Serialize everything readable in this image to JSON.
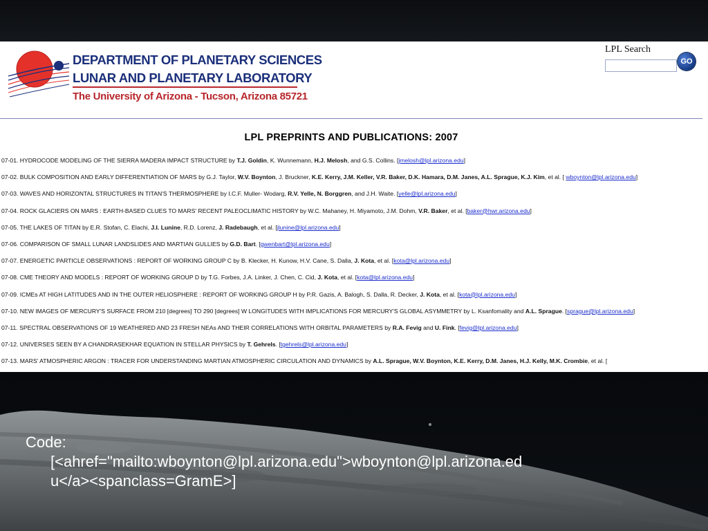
{
  "header": {
    "dept_line1": "DEPARTMENT OF PLANETARY SCIENCES",
    "dept_line2": "LUNAR AND PLANETARY LABORATORY",
    "university": "The University of Arizona - Tucson, Arizona 85721",
    "search_label": "LPL Search",
    "search_value": "",
    "go_label": "GO",
    "logo_icon": "planet-orbit-logo-icon"
  },
  "page_title": "LPL PREPRINTS AND PUBLICATIONS:  2007",
  "publications": [
    {
      "num": "07-01.",
      "segments": [
        {
          "t": "HYDROCODE MODELING OF THE SIERRA MADERA IMPACT STRUCTURE by "
        },
        {
          "t": "T.J. Goldin",
          "b": true
        },
        {
          "t": ", K. Wunnemann, "
        },
        {
          "t": "H.J. Melosh",
          "b": true
        },
        {
          "t": ", and G.S. Collins.  ["
        },
        {
          "t": "jmelosh@lpl.arizona.edu",
          "link": true
        },
        {
          "t": "]"
        }
      ]
    },
    {
      "num": "07-02.",
      "segments": [
        {
          "t": "BULK COMPOSITION AND EARLY DIFFERENTIATION OF MARS by G.J. Taylor, "
        },
        {
          "t": "W.V. Boynton",
          "b": true
        },
        {
          "t": ", J. Bruckner, "
        },
        {
          "t": "K.E. Kerry, J.M. Keller, V.R. Baker, D.K. Hamara, D.M. Janes, A.L. Sprague, K.J. Kim",
          "b": true
        },
        {
          "t": ", et al.  [ "
        },
        {
          "t": "wboynton@lpl.arizona.edu",
          "link": true
        },
        {
          "t": "]"
        }
      ]
    },
    {
      "num": "07-03.",
      "segments": [
        {
          "t": "WAVES AND HORIZONTAL STRUCTURES IN TITAN'S THERMOSPHERE by I.C.F. Muller- Wodarg, "
        },
        {
          "t": "R.V. Yelle, N. Borggren",
          "b": true
        },
        {
          "t": ", and J.H. Waite.  ["
        },
        {
          "t": "yelle@lpl.arizona.edu",
          "link": true
        },
        {
          "t": "]"
        }
      ]
    },
    {
      "num": "07-04.",
      "segments": [
        {
          "t": "ROCK GLACIERS ON MARS : EARTH-BASED CLUES TO MARS' RECENT PALEOCLIMATIC HISTORY by W.C. Mahaney, H. Miyamoto, J.M. Dohm, "
        },
        {
          "t": "V.R. Baker",
          "b": true
        },
        {
          "t": ", et al.  ["
        },
        {
          "t": "baker@hwr.arizona.edu",
          "link": true
        },
        {
          "t": "]"
        }
      ]
    },
    {
      "num": "07-05.",
      "segments": [
        {
          "t": "THE LAKES OF TITAN by E.R. Stofan, C. Elachi, "
        },
        {
          "t": "J.I. Lunine",
          "b": true
        },
        {
          "t": ", R.D. Lorenz, "
        },
        {
          "t": "J. Radebaugh",
          "b": true
        },
        {
          "t": ", et al.  ["
        },
        {
          "t": "jlunine@lpl.arizona.edu",
          "link": true
        },
        {
          "t": "]"
        }
      ]
    },
    {
      "num": "07-06.",
      "segments": [
        {
          "t": "COMPARISON OF SMALL LUNAR LANDSLIDES AND MARTIAN GULLIES by "
        },
        {
          "t": "G.D. Bart",
          "b": true
        },
        {
          "t": ".  ["
        },
        {
          "t": "gwenbart@lpl.arizona.edu",
          "link": true
        },
        {
          "t": "]"
        }
      ]
    },
    {
      "num": "07-07.",
      "segments": [
        {
          "t": "ENERGETIC PARTICLE OBSERVATIONS : REPORT OF WORKING GROUP C by B. Klecker, H. Kunow, H.V. Cane, S. Dalla, "
        },
        {
          "t": "J. Kota",
          "b": true
        },
        {
          "t": ", et al.  ["
        },
        {
          "t": "kota@lpl.arizona.edu",
          "link": true
        },
        {
          "t": "]"
        }
      ]
    },
    {
      "num": "07-08.",
      "segments": [
        {
          "t": "CME THEORY AND MODELS : REPORT OF WORKING GROUP D by T.G. Forbes, J.A. Linker, J. Chen, C. Cid, "
        },
        {
          "t": "J. Kota",
          "b": true
        },
        {
          "t": ", et al.  ["
        },
        {
          "t": "kota@lpl.arizona.edu",
          "link": true
        },
        {
          "t": "]"
        }
      ]
    },
    {
      "num": "07-09.",
      "segments": [
        {
          "t": "ICMEs AT HIGH LATITUDES AND IN THE OUTER HELIOSPHERE : REPORT OF WORKING GROUP H by P.R. Gazis, A. Balogh, S. Dalla, R. Decker, "
        },
        {
          "t": "J. Kota",
          "b": true
        },
        {
          "t": ", et al.  ["
        },
        {
          "t": "kota@lpl.arizona.edu",
          "link": true
        },
        {
          "t": "]"
        }
      ]
    },
    {
      "num": "07-10.",
      "segments": [
        {
          "t": "NEW IMAGES OF MERCURY'S SURFACE FROM 210 [degrees] TO 290 [degrees] W LONGITUDES WITH IMPLICATIONS FOR MERCURY'S GLOBAL ASYMMETRY by L. Ksanfomality and "
        },
        {
          "t": "A.L. Sprague",
          "b": true
        },
        {
          "t": ".  ["
        },
        {
          "t": "sprague@lpl.arizona.edu",
          "link": true
        },
        {
          "t": "]"
        }
      ]
    },
    {
      "num": "07-11.",
      "segments": [
        {
          "t": "SPECTRAL OBSERVATIONS OF 19 WEATHERED AND 23 FRESH NEAs AND THEIR CORRELATIONS WITH ORBITAL PARAMETERS by "
        },
        {
          "t": "R.A. Fevig",
          "b": true
        },
        {
          "t": " and "
        },
        {
          "t": "U. Fink",
          "b": true
        },
        {
          "t": ".  ["
        },
        {
          "t": "fevig@lpl.arizona.edu",
          "link": true
        },
        {
          "t": "]"
        }
      ]
    },
    {
      "num": "07-12.",
      "segments": [
        {
          "t": "UNIVERSES SEEN BY A CHANDRASEKHAR EQUATION IN STELLAR PHYSICS by "
        },
        {
          "t": "T. Gehrels",
          "b": true
        },
        {
          "t": ".  ["
        },
        {
          "t": "tgehrels@lpl.arizona.edu",
          "link": true
        },
        {
          "t": "]"
        }
      ]
    },
    {
      "num": "07-13.",
      "segments": [
        {
          "t": "MARS' ATMOSPHERIC ARGON : TRACER FOR UNDERSTANDING MARTIAN ATMOSPHERIC CIRCULATION AND DYNAMICS by "
        },
        {
          "t": "A.L. Sprague, W.V. Boynton, K.E. Kerry, D.M. Janes, H.J. Kelly, M.K. Crombie",
          "b": true
        },
        {
          "t": ", et al.  ["
        }
      ]
    }
  ],
  "code_caption": {
    "line1": "Code:",
    "line2": "[<ahref=\"mailto:wboynton@lpl.arizona.edu\">wboynton@lpl.arizona.ed",
    "line3": "u</a><spanclass=GramE>]"
  }
}
